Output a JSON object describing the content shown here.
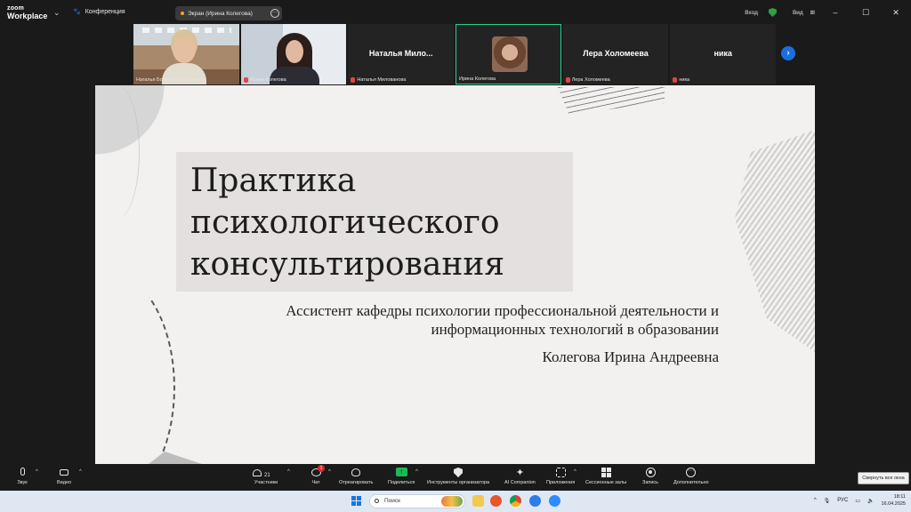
{
  "app": {
    "logo_line1": "zoom",
    "logo_line2": "Workplace",
    "conference_label": "Конференция",
    "share_label": "Экран (Ирина Колегова)",
    "signin": "Вход",
    "view": "Вид"
  },
  "participants": [
    {
      "name": "Наталья Борисовна Лисовская",
      "type": "video1",
      "muted": false
    },
    {
      "name": "Ирина Колегова",
      "type": "video2",
      "muted": true
    },
    {
      "name": "Наталья Милованова",
      "display": "Наталья  Мило...",
      "type": "name",
      "muted": true
    },
    {
      "name": "Ирина Колегова",
      "type": "avatar",
      "muted": false,
      "active": true
    },
    {
      "name": "Лера Холомеева",
      "display": "Лера Холомеева",
      "type": "name",
      "muted": true
    },
    {
      "name": "ника",
      "display": "ника",
      "type": "name",
      "muted": true
    }
  ],
  "slide": {
    "title": "Практика\nпсихологического\nконсультирования",
    "subtitle_line1": "Ассистент кафедры психологии профессиональной деятельности и",
    "subtitle_line2": "информационных технологий в образовании",
    "author": "Колегова Ирина Андреевна"
  },
  "toolbar": {
    "audio": "Звук",
    "video": "Видео",
    "participants": "Участники",
    "participants_count": "21",
    "chat": "Чат",
    "chat_badge": "1",
    "react": "Отреагировать",
    "share": "Поделиться",
    "host_tools": "Инструменты организатора",
    "ai_companion": "AI Companion",
    "apps": "Приложения",
    "breakout": "Сессионные залы",
    "record": "Запись",
    "more": "Дополнительно",
    "tooltip": "Свернуть все окна"
  },
  "taskbar": {
    "search_placeholder": "Поиск",
    "lang": "РУС",
    "time": "18:11",
    "date": "16.04.2025"
  }
}
